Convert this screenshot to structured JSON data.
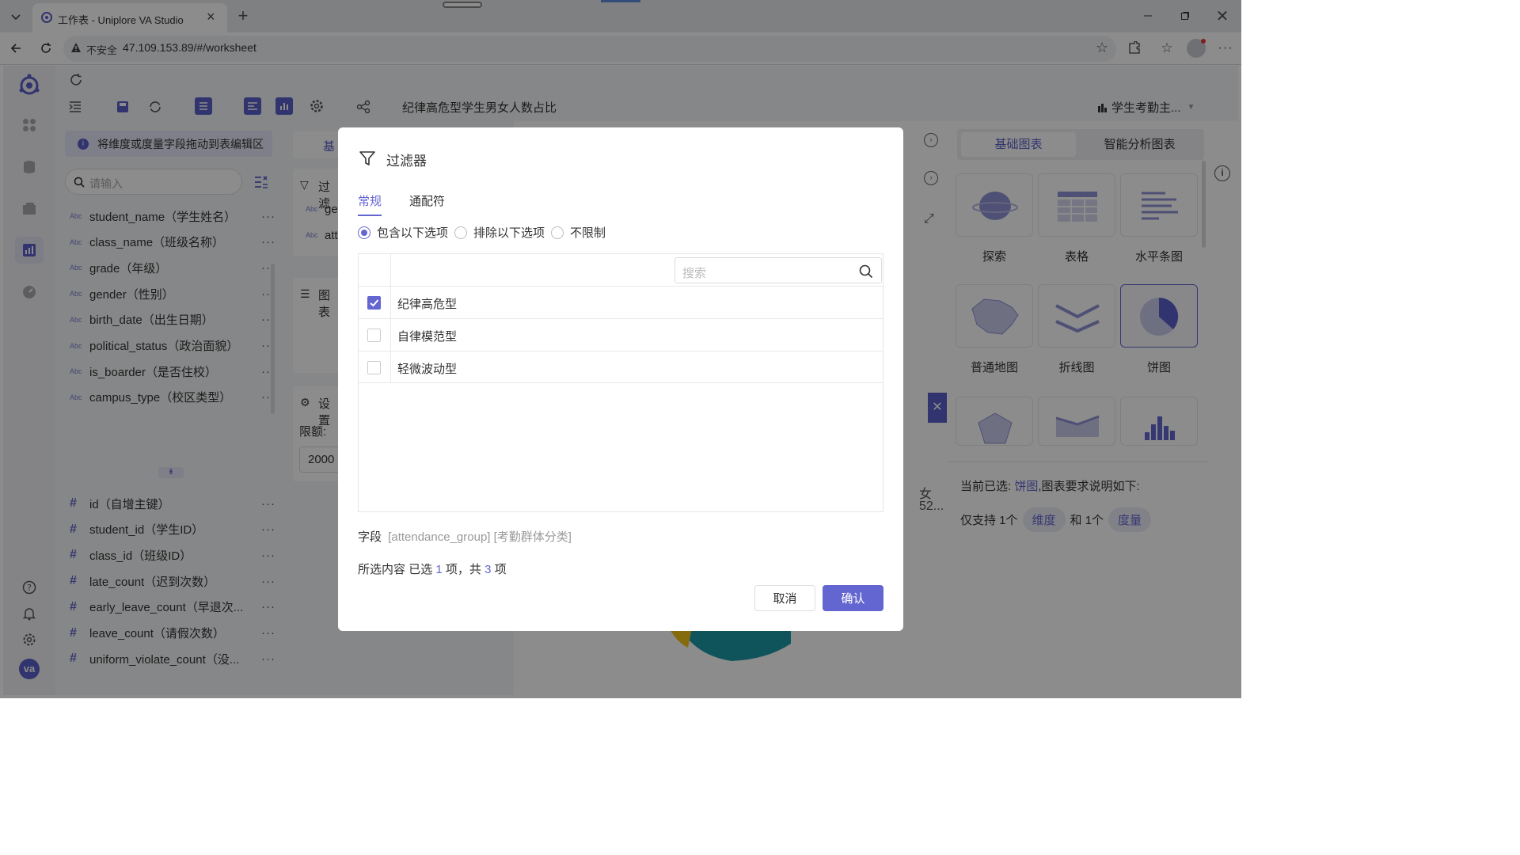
{
  "browser": {
    "tab_title": "工作表 - Uniplore VA Studio",
    "security": "不安全",
    "url": "47.109.153.89/#/worksheet"
  },
  "toolbar": {
    "chart_title": "纪律高危型学生男女人数占比",
    "dataset": "学生考勤主..."
  },
  "field_panel": {
    "hint": "将维度或度量字段拖动到表编辑区",
    "search_placeholder": "请输入",
    "dimensions": [
      {
        "type": "Abc",
        "name": "student_name（学生姓名）"
      },
      {
        "type": "Abc",
        "name": "class_name（班级名称）"
      },
      {
        "type": "Abc",
        "name": "grade（年级）"
      },
      {
        "type": "Abc",
        "name": "gender（性别）"
      },
      {
        "type": "Abc",
        "name": "birth_date（出生日期）"
      },
      {
        "type": "Abc",
        "name": "political_status（政治面貌）"
      },
      {
        "type": "Abc",
        "name": "is_boarder（是否住校）"
      },
      {
        "type": "Abc",
        "name": "campus_type（校区类型）"
      }
    ],
    "measures": [
      {
        "type": "#",
        "name": "id（自增主键）"
      },
      {
        "type": "#",
        "name": "student_id（学生ID）"
      },
      {
        "type": "#",
        "name": "class_id（班级ID）"
      },
      {
        "type": "#",
        "name": "late_count（迟到次数）"
      },
      {
        "type": "#",
        "name": "early_leave_count（早退次..."
      },
      {
        "type": "#",
        "name": "leave_count（请假次数）"
      },
      {
        "type": "#",
        "name": "uniform_violate_count（没..."
      }
    ],
    "more": "···"
  },
  "middle_panel": {
    "tab_partial": "基",
    "filter_partial": "过滤",
    "filter_item1": "ge",
    "filter_item2": "att",
    "chart_partial": "图表",
    "settings_partial": "设置",
    "limit_label": "限额:",
    "limit_value": "2000",
    "legend_partial": "女",
    "legend_value_partial": "52..."
  },
  "right_panel": {
    "tab_basic": "基础图表",
    "tab_smart": "智能分析图表",
    "charts": [
      "探索",
      "表格",
      "水平条图",
      "普通地图",
      "折线图",
      "饼图"
    ],
    "selected_prefix": "当前已选:",
    "selected_chart": "饼图",
    "selected_suffix": ",图表要求说明如下:",
    "req_prefix": "仅支持 1个",
    "req_dim": "维度",
    "req_mid": "和 1个",
    "req_measure": "度量"
  },
  "dialog": {
    "title": "过滤器",
    "tabs": [
      "常规",
      "通配符"
    ],
    "radios": [
      "包含以下选项",
      "排除以下选项",
      "不限制"
    ],
    "search_placeholder": "搜索",
    "options": [
      {
        "label": "纪律高危型",
        "checked": true
      },
      {
        "label": "自律模范型",
        "checked": false
      },
      {
        "label": "轻微波动型",
        "checked": false
      }
    ],
    "field_label": "字段",
    "field_value": "[attendance_group] [考勤群体分类]",
    "sel_label": "所选内容",
    "sel_a": "已选",
    "sel_count": "1",
    "sel_b": "项，共",
    "sel_total": "3",
    "sel_c": "项",
    "cancel": "取消",
    "confirm": "确认"
  },
  "user_avatar": "va",
  "colors": {
    "accent": "#6366d0"
  }
}
